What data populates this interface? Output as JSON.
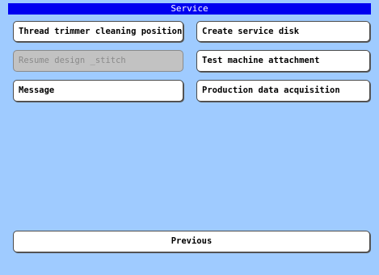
{
  "window": {
    "title": "Service"
  },
  "buttons": {
    "thread_trimmer": "Thread trimmer cleaning position",
    "create_service_disk": "Create service disk",
    "resume_design": "Resume design _stitch",
    "test_machine_attachment": "Test machine attachment",
    "message": "Message",
    "production_data": "Production data acquisition",
    "previous": "Previous"
  },
  "colors": {
    "background": "#9fcbff",
    "titlebar": "#0000f0",
    "button": "#ffffff",
    "button_disabled": "#c2c2c2"
  }
}
